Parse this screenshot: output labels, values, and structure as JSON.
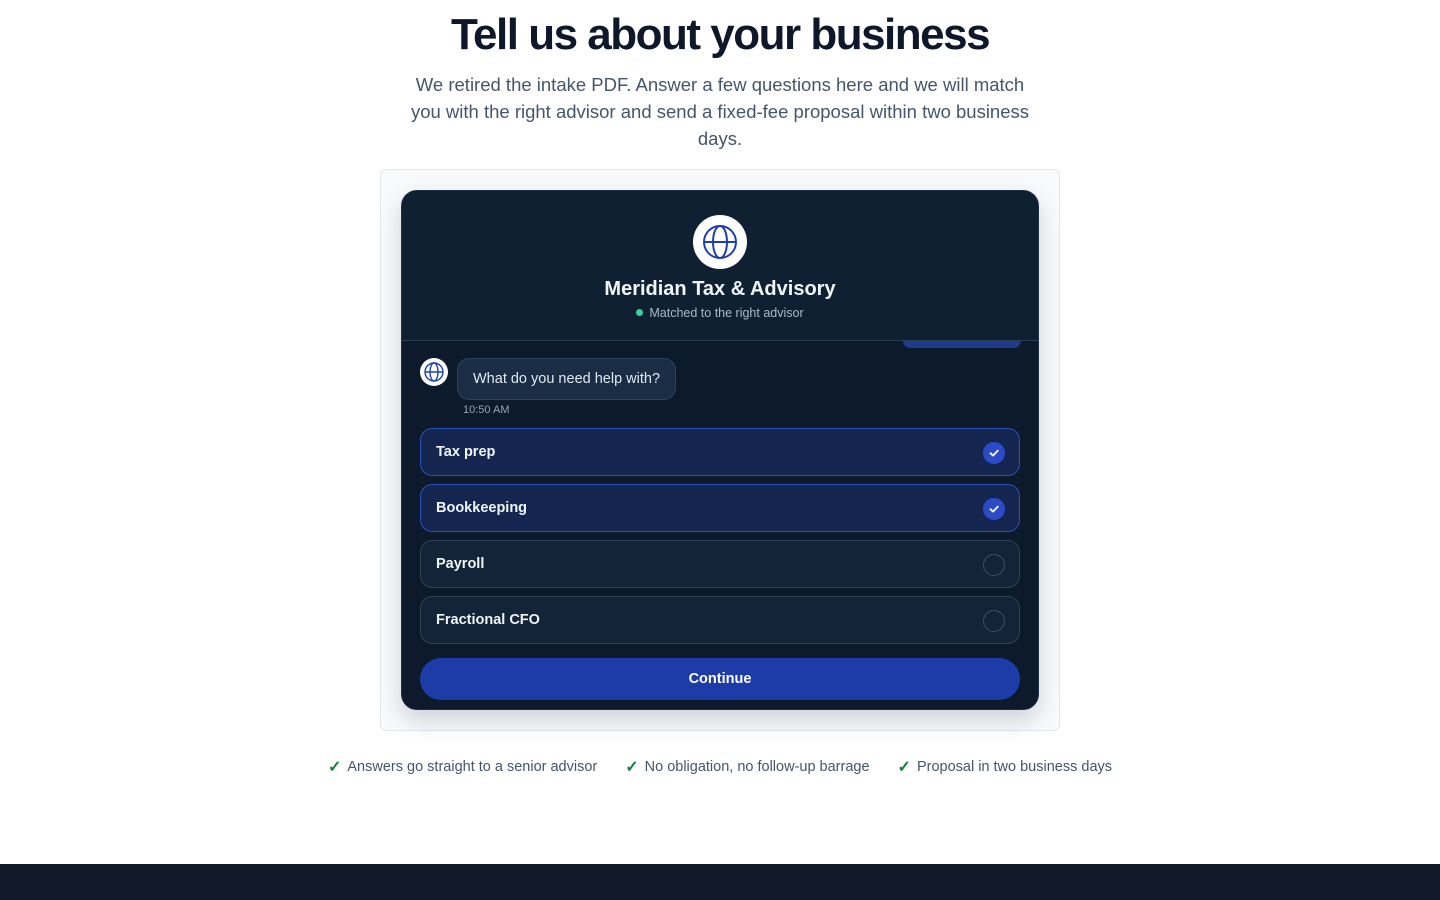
{
  "hero": {
    "title": "Tell us about your business",
    "subtitle": "We retired the intake PDF. Answer a few questions here and we will match you with the right advisor and send a fixed-fee proposal within two business days."
  },
  "chat": {
    "brand_name": "Meridian Tax & Advisory",
    "brand_icon": "globe-icon",
    "status_text": "Matched to the right advisor",
    "status_color": "#34d399",
    "bot_message": "What do you need help with?",
    "bot_message_time": "10:50 AM",
    "options": [
      {
        "label": "Tax prep",
        "selected": true
      },
      {
        "label": "Bookkeeping",
        "selected": true
      },
      {
        "label": "Payroll",
        "selected": false
      },
      {
        "label": "Fractional CFO",
        "selected": false
      }
    ],
    "continue_label": "Continue"
  },
  "benefits": [
    {
      "icon": "checkmark-icon",
      "text": "Answers go straight to a senior advisor"
    },
    {
      "icon": "checkmark-icon",
      "text": "No obligation, no follow-up barrage"
    },
    {
      "icon": "checkmark-icon",
      "text": "Proposal in two business days"
    }
  ],
  "colors": {
    "accent": "#1e3ca8",
    "card_background": "#0c1a2b",
    "check_green": "#15803d"
  }
}
